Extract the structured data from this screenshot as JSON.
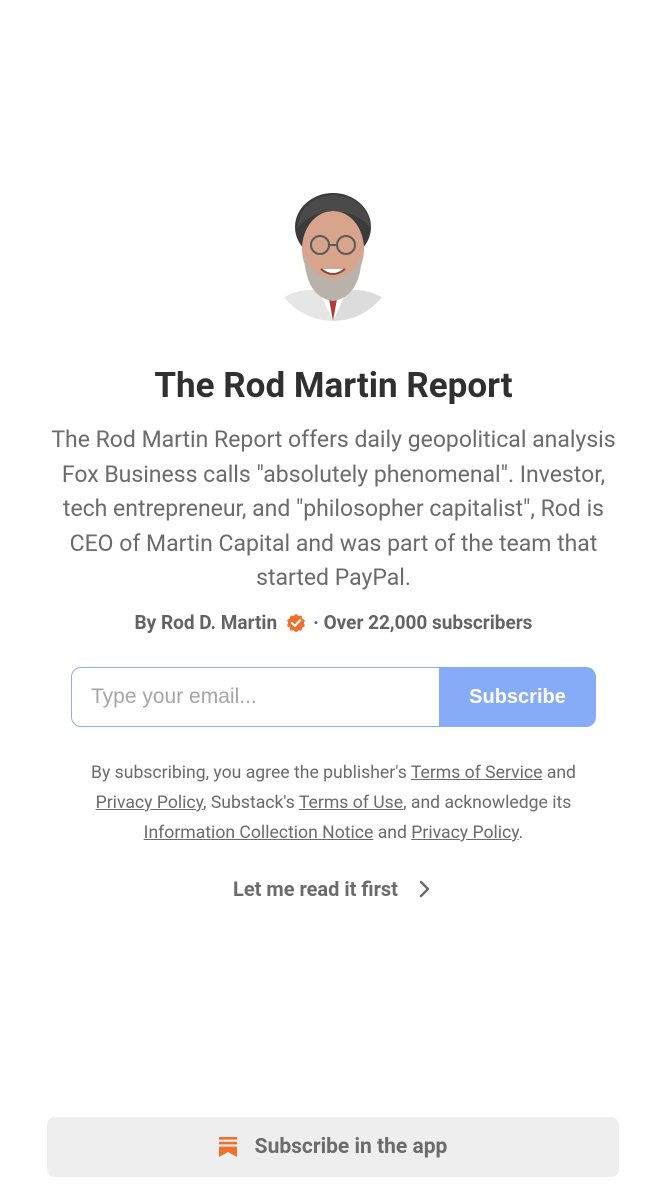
{
  "publication": {
    "title": "The Rod Martin Report",
    "description": "The Rod Martin Report offers daily geopolitical analysis Fox Business calls \"absolutely phenomenal\". Investor, tech entrepreneur, and \"philosopher capitalist\", Rod is CEO of Martin Capital and was part of the team that started PayPal.",
    "author_prefix": "By Rod D. Martin",
    "subscriber_text": "· Over 22,000 subscribers",
    "avatar_icon": "author-avatar"
  },
  "form": {
    "email_placeholder": "Type your email...",
    "subscribe_label": "Subscribe"
  },
  "legal": {
    "p1": "By subscribing, you agree the publisher's ",
    "tos": "Terms of Service",
    "p2": " and ",
    "privacy1": "Privacy Policy",
    "p3": ", Substack's ",
    "terms_use": "Terms of Use",
    "p4": ", and acknowledge its ",
    "info_notice": "Information Collection Notice",
    "p5": " and ",
    "privacy2": "Privacy Policy",
    "p6": "."
  },
  "read_first": "Let me read it first",
  "app_bar": {
    "label": "Subscribe in the app",
    "icon": "substack-icon"
  },
  "colors": {
    "accent": "#86acf7",
    "verified": "#f26e2b",
    "substack": "#f26e2b"
  }
}
